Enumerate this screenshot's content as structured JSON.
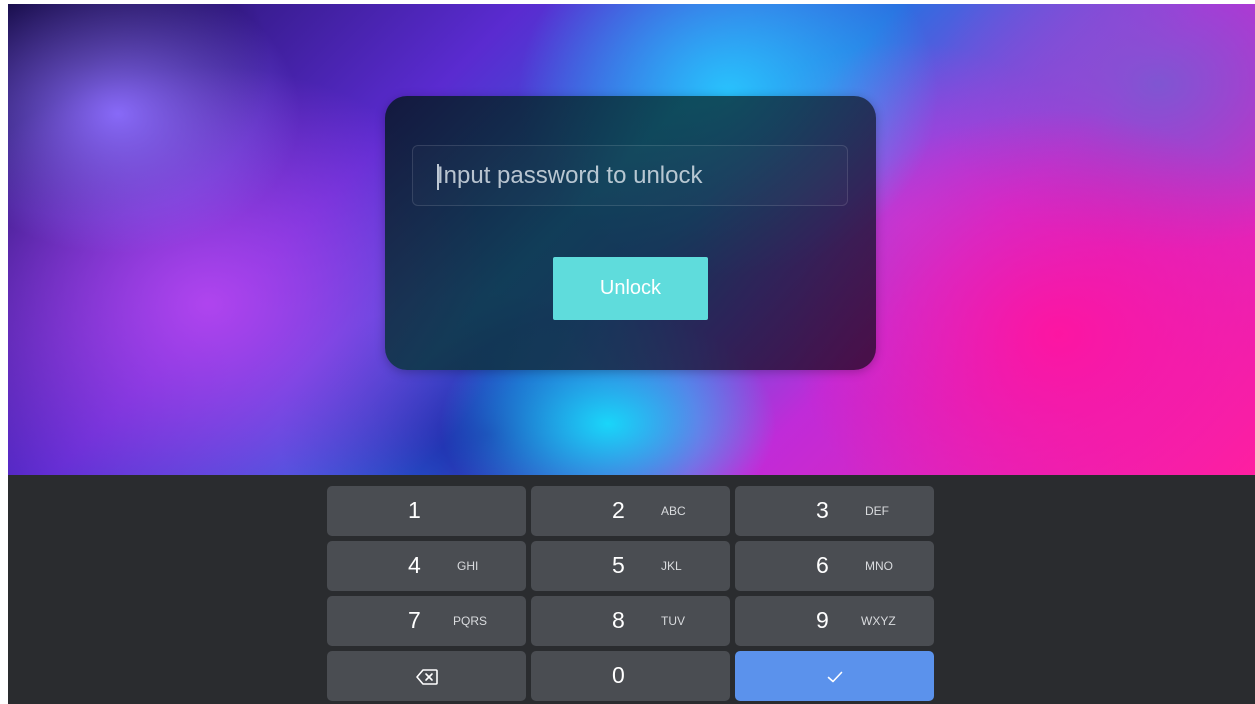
{
  "lock_dialog": {
    "password_placeholder": "Input password to unlock",
    "password_value": "",
    "unlock_label": "Unlock"
  },
  "keypad": {
    "keys": [
      {
        "digit": "1",
        "letters": ""
      },
      {
        "digit": "2",
        "letters": "ABC"
      },
      {
        "digit": "3",
        "letters": "DEF"
      },
      {
        "digit": "4",
        "letters": "GHI"
      },
      {
        "digit": "5",
        "letters": "JKL"
      },
      {
        "digit": "6",
        "letters": "MNO"
      },
      {
        "digit": "7",
        "letters": "PQRS"
      },
      {
        "digit": "8",
        "letters": "TUV"
      },
      {
        "digit": "9",
        "letters": "WXYZ"
      },
      {
        "digit": "0",
        "letters": ""
      }
    ],
    "backspace_icon": "backspace-icon",
    "enter_icon": "checkmark-icon"
  },
  "colors": {
    "unlock_button": "#5fdcdc",
    "enter_key": "#5b92ec",
    "key_background": "#4a4d52",
    "keyboard_background": "#2a2c2f"
  }
}
